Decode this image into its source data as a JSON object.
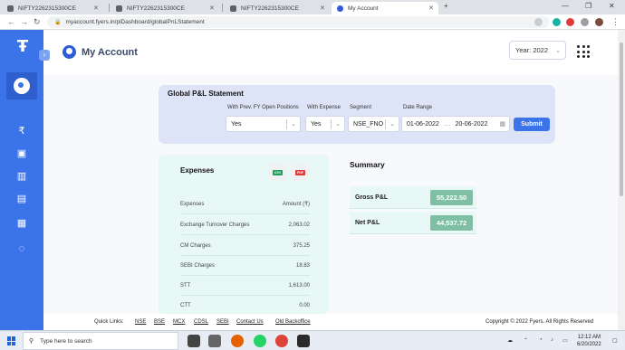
{
  "browser": {
    "tabs": [
      {
        "label": "NIFTY2262315300CE",
        "active": false
      },
      {
        "label": "NIFTY2262315300CE",
        "active": false
      },
      {
        "label": "NIFTY2262315300CE",
        "active": false
      },
      {
        "label": "My Account",
        "active": true
      }
    ],
    "url": "myaccount.fyers.in/plDashboard/globalPnLStatement"
  },
  "header": {
    "title": "My Account",
    "year_select": "Year: 2022"
  },
  "statement": {
    "title": "Global P&L Statement",
    "filters": [
      {
        "label": "With Prev. FY Open Positions",
        "value": "Yes"
      },
      {
        "label": "With Expense",
        "value": "Yes"
      },
      {
        "label": "Segment",
        "value": "NSE_FNO"
      }
    ],
    "date_range": {
      "label": "Date Range",
      "from": "01-06-2022",
      "sep": "....",
      "to": "20-06-2022"
    },
    "submit": "Submit"
  },
  "expenses": {
    "title": "Expenses",
    "csv_label": "CSV",
    "pdf_label": "PDF",
    "header": {
      "name": "Expenses",
      "amount": "Amount (₹)"
    },
    "rows": [
      {
        "name": "Exchange Turnover Charges",
        "amount": "2,063.02"
      },
      {
        "name": "CM Charges",
        "amount": "375.25"
      },
      {
        "name": "SEBI Charges",
        "amount": "18.83"
      },
      {
        "name": "STT",
        "amount": "1,613.00"
      },
      {
        "name": "CTT",
        "amount": "0.00"
      }
    ]
  },
  "summary": {
    "title": "Summary",
    "rows": [
      {
        "label": "Gross P&L",
        "value": "55,222.50"
      },
      {
        "label": "Net P&L",
        "value": "44,537.72"
      }
    ]
  },
  "footer": {
    "quick_links_label": "Quick Links:",
    "links": [
      "NSE",
      "BSE",
      "MCX",
      "CDSL",
      "SEBI",
      "Contact Us",
      "Old Backoffice"
    ],
    "copyright": "Copyright © 2022 Fyers. All Rights Reserved"
  },
  "taskbar": {
    "search_placeholder": "Type here to search",
    "time": "12:12 AM",
    "date": "6/20/2022"
  },
  "colors": {
    "brand_blue": "#3b73e8",
    "pnl_green": "#7fbfa4",
    "card_teal": "#e8f8f7"
  }
}
